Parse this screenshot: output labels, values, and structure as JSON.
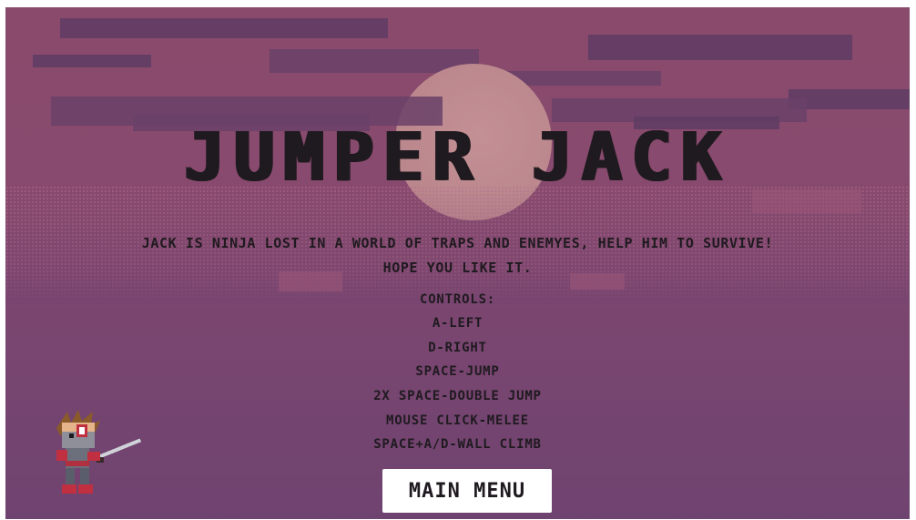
{
  "game": {
    "title": "JUMPER JACK",
    "description_line1": "JACK IS NINJA LOST IN A WORLD OF TRAPS AND ENEMYES, HELP HIM TO SURVIVE!",
    "description_line2": "HOPE YOU LIKE IT.",
    "controls_heading": "CONTROLS:",
    "controls": [
      "A-LEFT",
      "D-RIGHT",
      "SPACE-JUMP",
      "2X SPACE-DOUBLE JUMP",
      "MOUSE CLICK-MELEE",
      "SPACE+A/D-WALL CLIMB"
    ],
    "main_menu_label": "MAIN MENU"
  },
  "colors": {
    "sky_top": "#8a4a6c",
    "sky_bottom": "#6f4370",
    "moon": "#c08a90",
    "text": "#1f1a1f",
    "button_bg": "#ffffff"
  },
  "icons": {
    "character": "ninja-character-icon",
    "moon": "moon-icon"
  }
}
